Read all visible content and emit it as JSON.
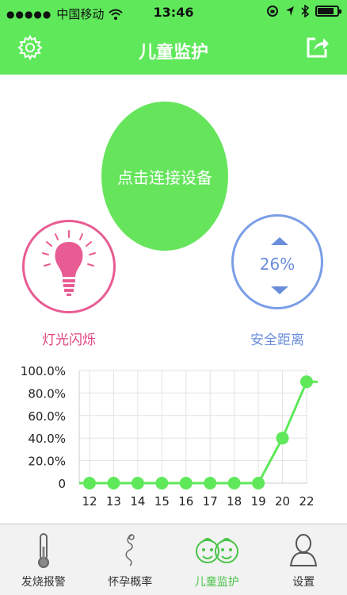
{
  "status_bar": {
    "carrier": "中国移动",
    "time": "13:46"
  },
  "header": {
    "title": "儿童监护"
  },
  "connect_button": {
    "label": "点击连接设备"
  },
  "light": {
    "label": "灯光闪烁",
    "color": "#e85c93"
  },
  "distance": {
    "label": "安全距离",
    "value": "26%",
    "color": "#6b8edc"
  },
  "tabs": [
    {
      "label": "发烧报警",
      "icon": "thermometer-icon"
    },
    {
      "label": "怀孕概率",
      "icon": "fetus-icon"
    },
    {
      "label": "儿童监护",
      "icon": "kids-faces-icon",
      "active": true
    },
    {
      "label": "设置",
      "icon": "person-icon"
    }
  ],
  "chart_data": {
    "type": "line",
    "categories": [
      "12",
      "13",
      "14",
      "15",
      "16",
      "17",
      "18",
      "19",
      "20",
      "22"
    ],
    "values": [
      0,
      0,
      0,
      0,
      0,
      0,
      0,
      0,
      40,
      90
    ],
    "yticks": [
      "100.0%",
      "80.0%",
      "60.0%",
      "40.0%",
      "20.0%",
      "0"
    ],
    "ylim": [
      0,
      100
    ],
    "grid": true,
    "color": "#5ee85a"
  }
}
